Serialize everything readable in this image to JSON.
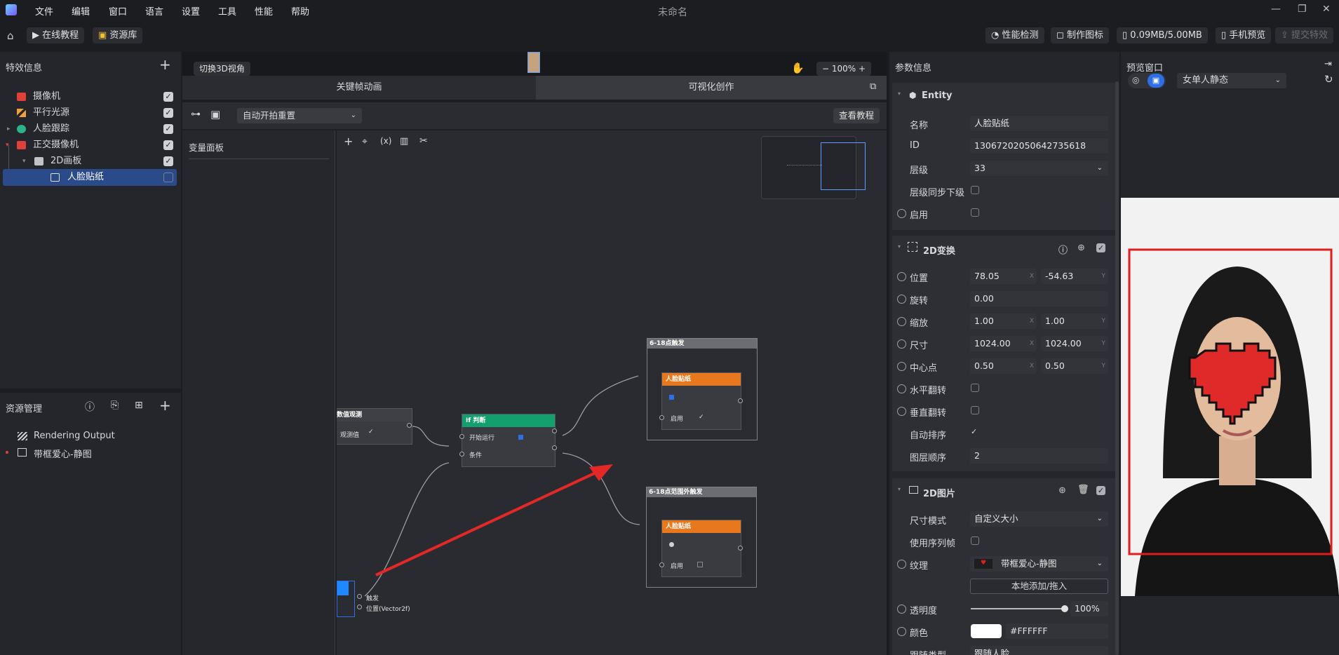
{
  "menu": {
    "items": [
      "文件",
      "编辑",
      "窗口",
      "语言",
      "设置",
      "工具",
      "性能",
      "帮助"
    ]
  },
  "window": {
    "title": "未命名"
  },
  "toolbar": {
    "tutorial": "在线教程",
    "library": "资源库",
    "perf_check": "性能检测",
    "make_icon": "制作图标",
    "size": "0.09MB/5.00MB",
    "phone_preview": "手机预览",
    "submit": "提交特效"
  },
  "effects": {
    "title": "特效信息",
    "items": [
      {
        "label": "摄像机",
        "checked": true
      },
      {
        "label": "平行光源",
        "checked": true
      },
      {
        "label": "人脸跟踪",
        "checked": true
      },
      {
        "label": "正交摄像机",
        "checked": true
      },
      {
        "label": "2D画板",
        "checked": true
      },
      {
        "label": "人脸贴纸",
        "checked": false
      }
    ]
  },
  "resources": {
    "title": "资源管理",
    "items": [
      "Rendering Output",
      "带框爱心-静图"
    ]
  },
  "center": {
    "switch3d": "切换3D视角",
    "zoom": "100%",
    "tab_keyframe": "关键帧动画",
    "tab_visual": "可视化创作",
    "autoplay": "自动开拍重置",
    "tutorial": "查看教程",
    "var_panel": "变量面板"
  },
  "graph": {
    "node_observe_title": "数值观测",
    "node_observe_port": "观测值",
    "node_if_title": "If 判断",
    "node_if_port1": "开始运行",
    "node_if_port2": "条件",
    "group1_title": "6-18点触发",
    "group2_title": "6-18点范围外触发",
    "sticker": "人脸贴纸",
    "enable": "启用",
    "trigger": "触发",
    "position": "位置(Vector2f)"
  },
  "params": {
    "title": "参数信息",
    "entity": {
      "header": "Entity",
      "name_label": "名称",
      "name": "人脸贴纸",
      "id_label": "ID",
      "id": "1306720205064273561​8",
      "layer_label": "层级",
      "layer": "33",
      "layer_sync_label": "层级同步下级",
      "enable_label": "启用"
    },
    "transform": {
      "header": "2D变换",
      "pos_label": "位置",
      "pos_x": "78.05",
      "pos_y": "-54.63",
      "rot_label": "旋转",
      "rot": "0.00",
      "scale_label": "缩放",
      "scale_x": "1.00",
      "scale_y": "1.00",
      "size_label": "尺寸",
      "size_w": "1024.00",
      "size_h": "1024.00",
      "pivot_label": "中心点",
      "pivot_x": "0.50",
      "pivot_y": "0.50",
      "flip_h_label": "水平翻转",
      "flip_v_label": "垂直翻转",
      "autosort_label": "自动排序",
      "order_label": "图层顺序",
      "order": "2",
      "axis_x": "X",
      "axis_y": "Y"
    },
    "image": {
      "header": "2D图片",
      "sizemode_label": "尺寸模式",
      "sizemode": "自定义大小",
      "seq_label": "使用序列帧",
      "texture_label": "纹理",
      "texture": "带框爱心-静图",
      "add_local": "本地添加/拖入",
      "opacity_label": "透明度",
      "opacity": "100%",
      "opacity_value": 1.0,
      "color_label": "颜色",
      "color": "#FFFFFF",
      "follow_label": "跟随类型",
      "follow": "跟随人脸"
    }
  },
  "preview": {
    "title": "预览窗口",
    "model": "女单人静态"
  },
  "colors": {
    "accent": "#2f6fe4",
    "orange": "#e8781e",
    "green": "#14a06e",
    "red": "#e02020"
  }
}
